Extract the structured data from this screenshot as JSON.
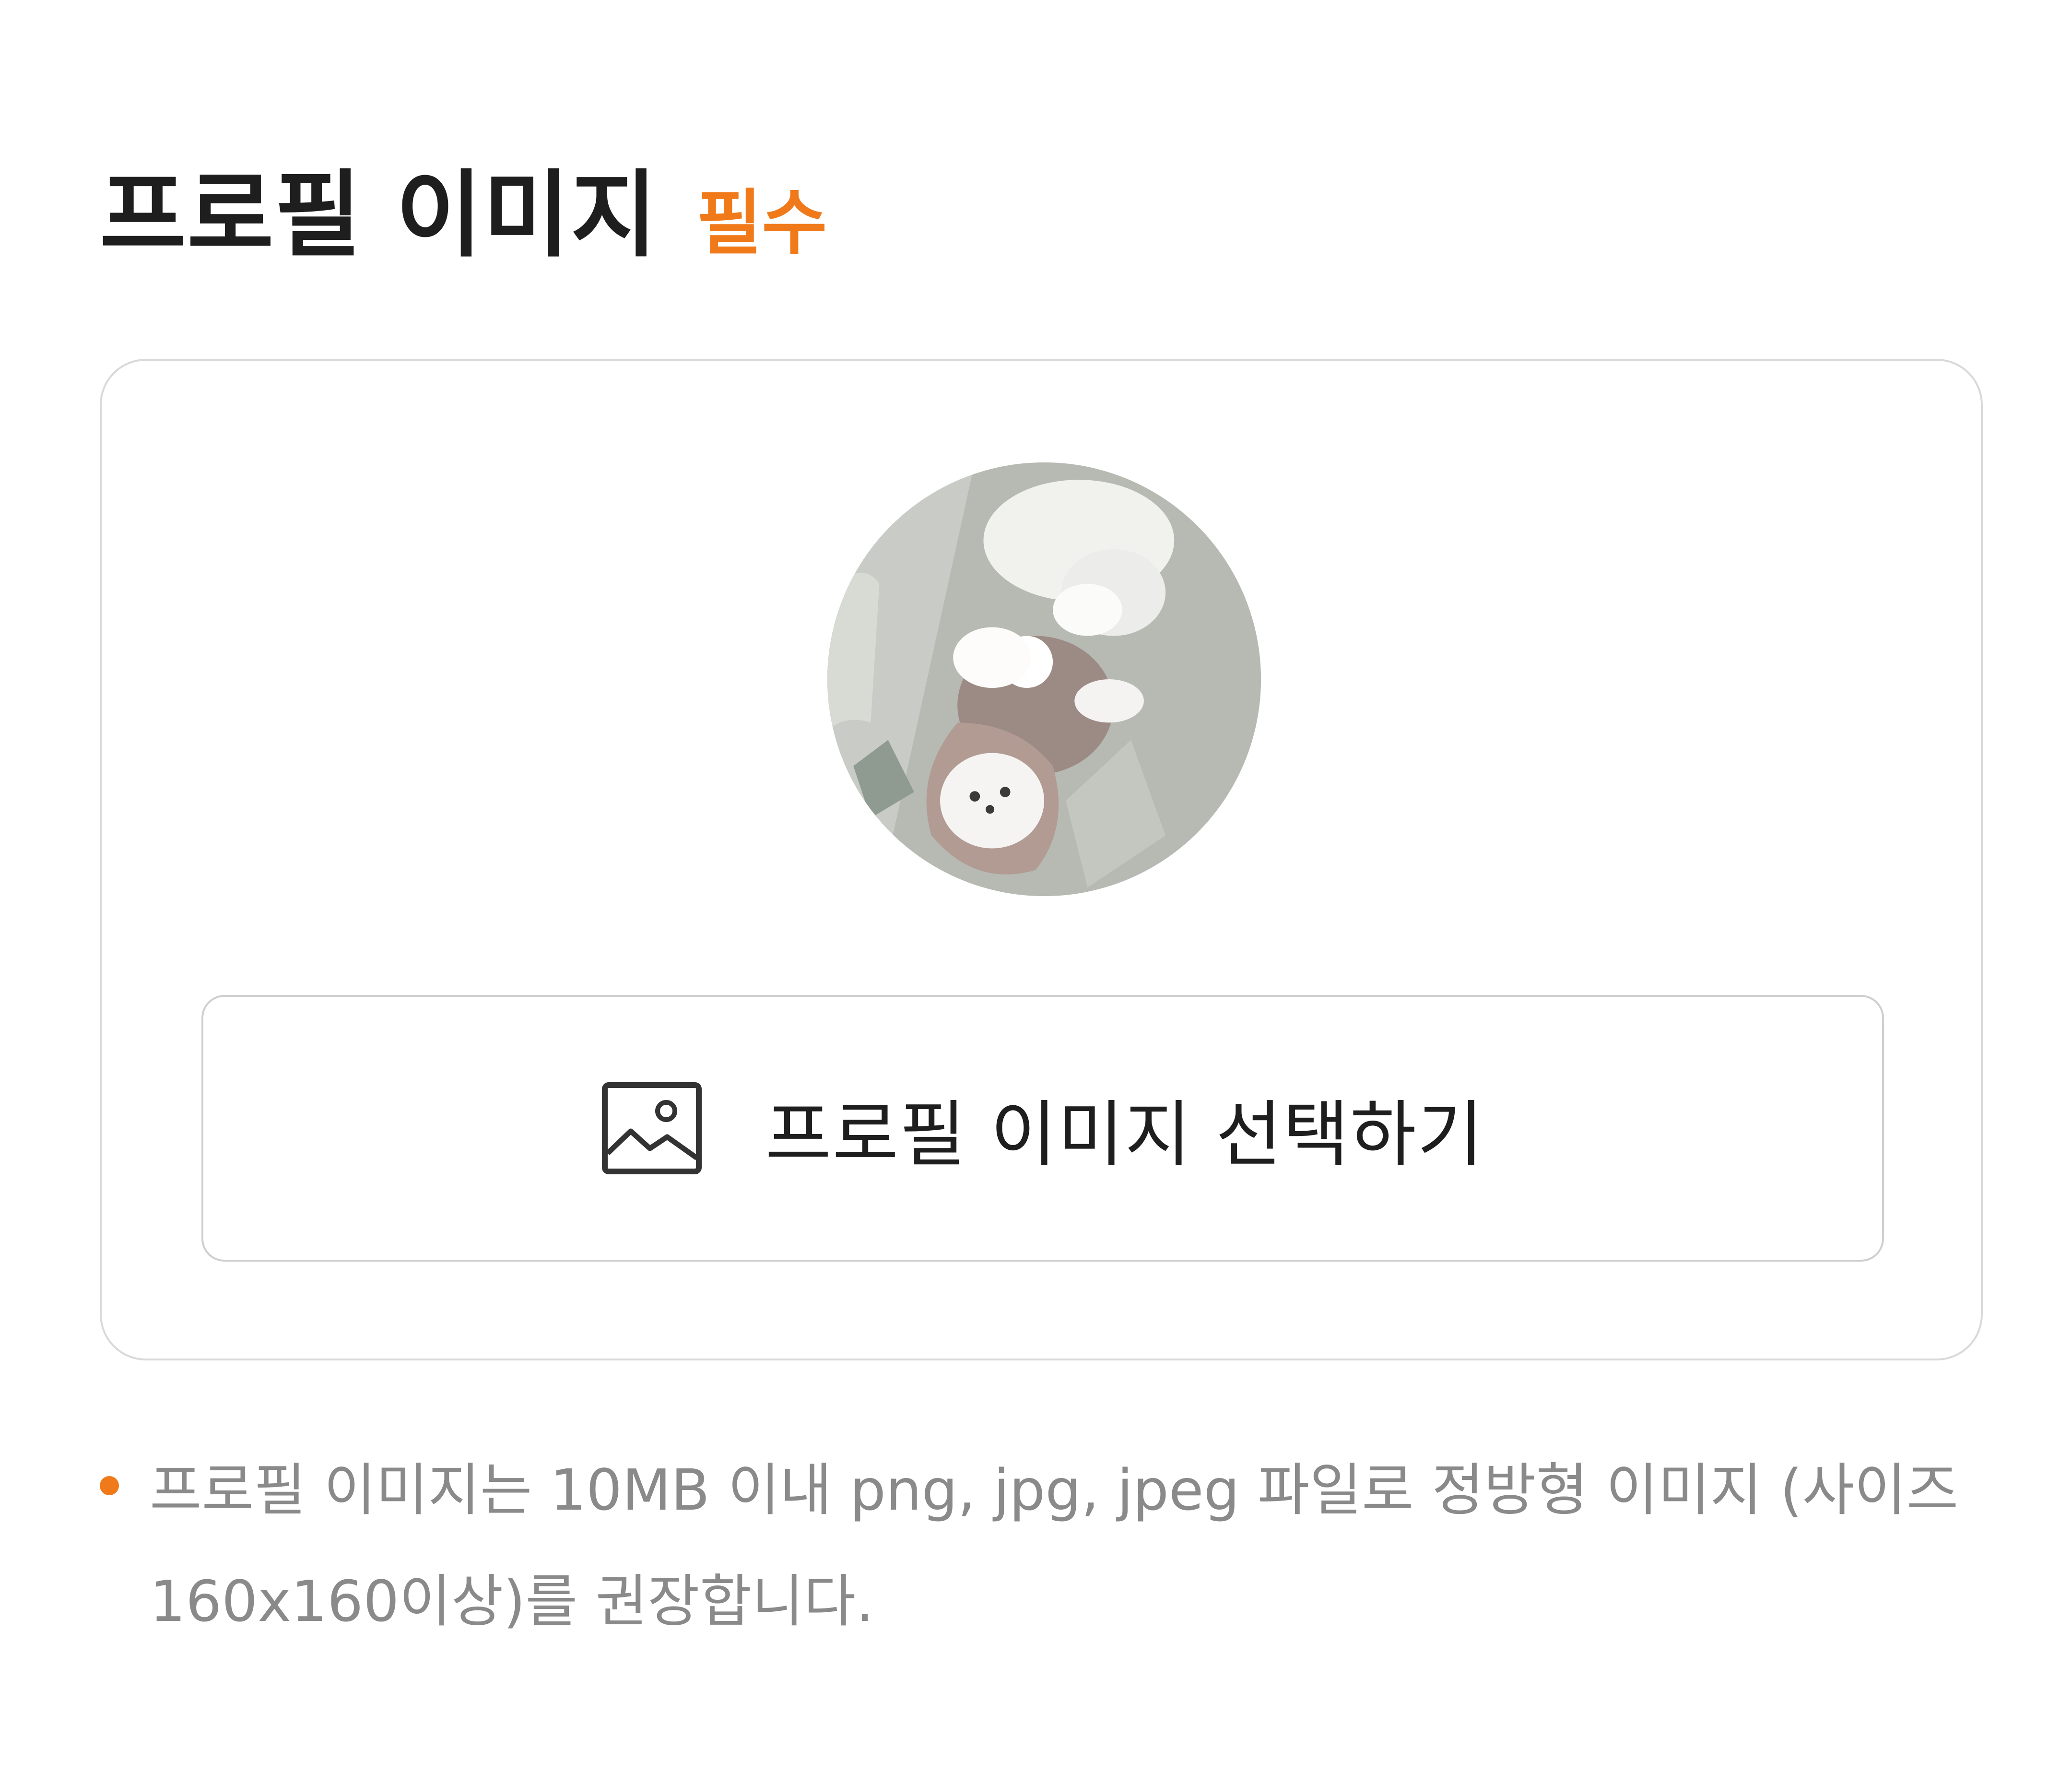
{
  "section": {
    "title": "프로필 이미지",
    "required_label": "필수"
  },
  "profile_image": {
    "alt": "프로필 이미지"
  },
  "select_button": {
    "icon": "image-icon",
    "label": "프로필 이미지 선택하기"
  },
  "note": {
    "text": "프로필 이미지는 10MB 이내 png, jpg, jpeg 파일로 정방형 이미지 (사이즈 160x160이상)를 권장합니다."
  },
  "colors": {
    "accent": "#f07a1a",
    "title": "#1e1e1e",
    "muted": "#8a8a8a",
    "border": "#d9d9d9"
  }
}
